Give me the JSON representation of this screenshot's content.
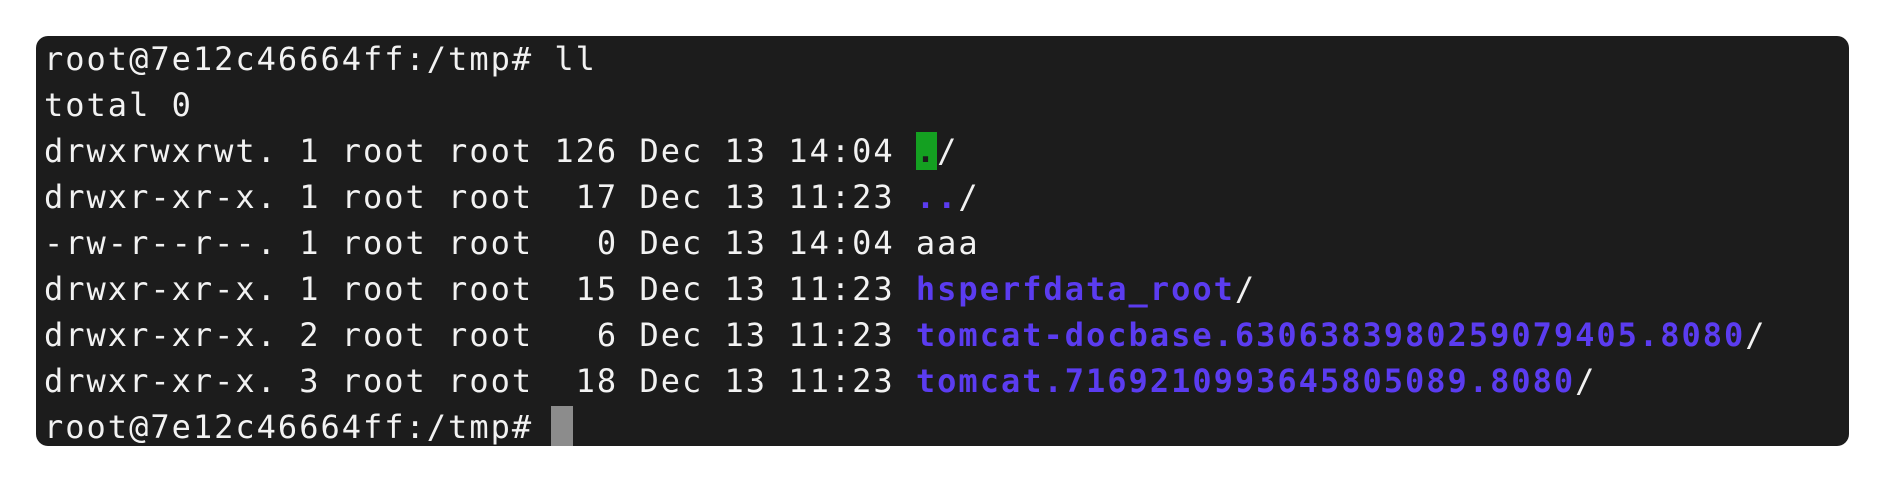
{
  "prompt": "root@7e12c46664ff:/tmp#",
  "command": "ll",
  "total_line": "total 0",
  "entries": [
    {
      "meta": "drwxrwxrwt. 1 root root 126 Dec 13 14:04 ",
      "name": ".",
      "suffix": "/"
    },
    {
      "meta": "drwxr-xr-x. 1 root root  17 Dec 13 11:23 ",
      "name": "..",
      "suffix": "/"
    },
    {
      "meta": "-rw-r--r--. 1 root root   0 Dec 13 14:04 ",
      "name": "aaa",
      "suffix": ""
    },
    {
      "meta": "drwxr-xr-x. 1 root root  15 Dec 13 11:23 ",
      "name": "hsperfdata_root",
      "suffix": "/"
    },
    {
      "meta": "drwxr-xr-x. 2 root root   6 Dec 13 11:23 ",
      "name": "tomcat-docbase.6306383980259079405.8080",
      "suffix": "/"
    },
    {
      "meta": "drwxr-xr-x. 3 root root  18 Dec 13 11:23 ",
      "name": "tomcat.7169210993645805089.8080",
      "suffix": "/"
    }
  ],
  "colors": {
    "background": "#1c1c1c",
    "text": "#f2f2f2",
    "directory": "#5b3cf0",
    "highlight": "#14a021",
    "cursor": "#8c8c8c"
  }
}
